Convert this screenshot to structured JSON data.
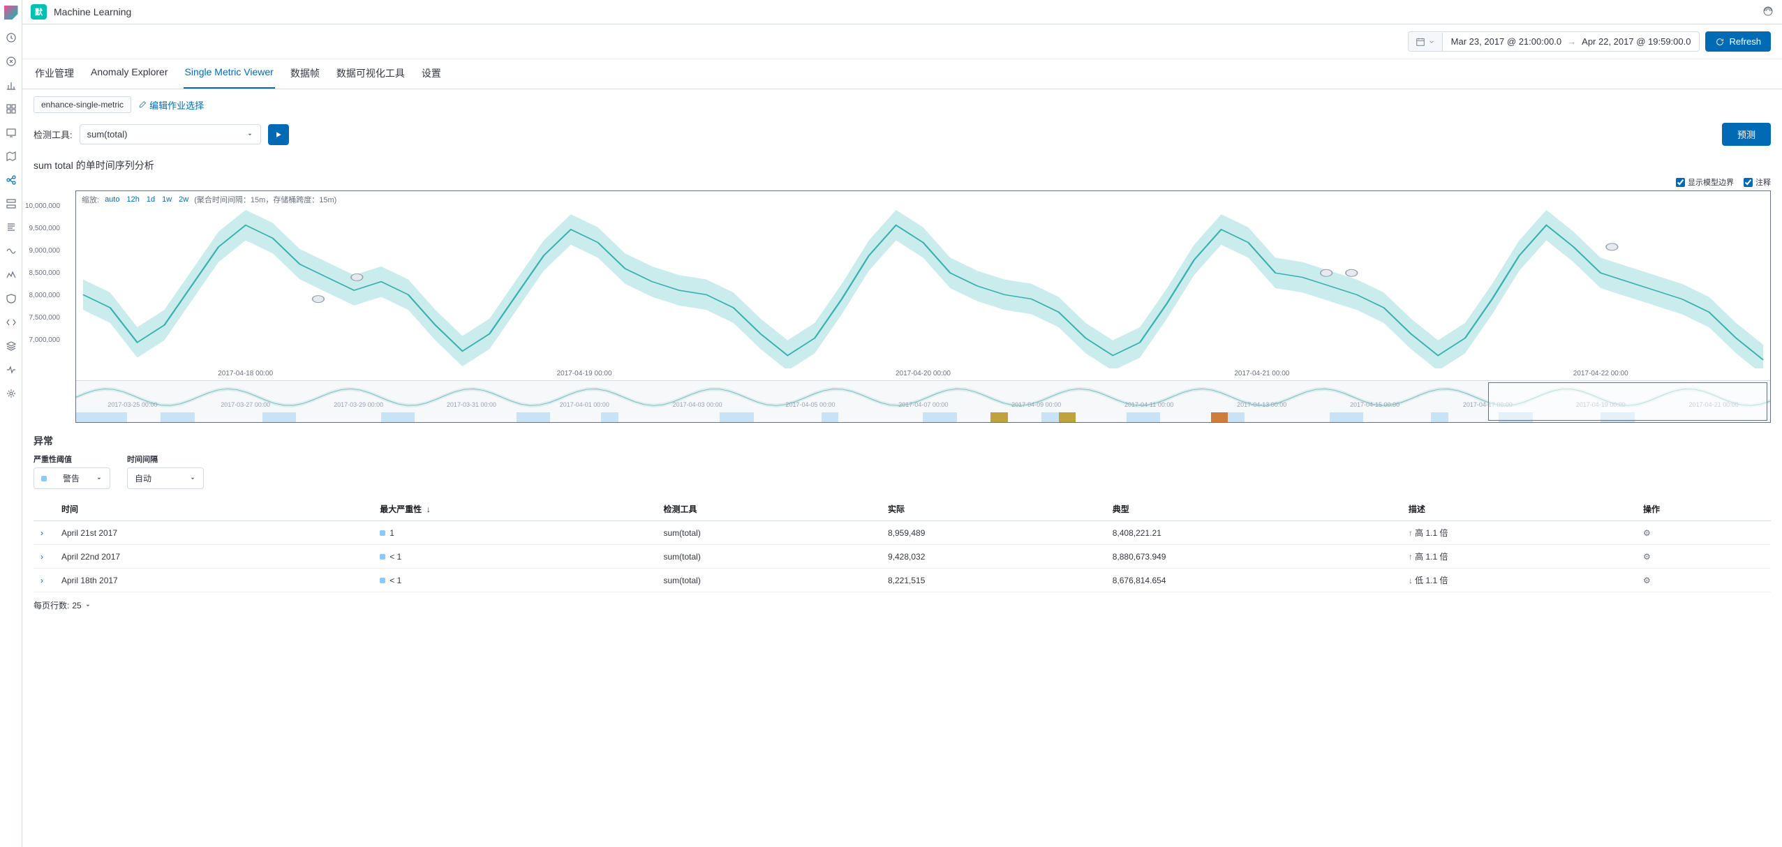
{
  "header": {
    "badge": "默",
    "breadcrumb": "Machine Learning"
  },
  "date": {
    "from": "Mar 23, 2017 @ 21:00:00.0",
    "to": "Apr 22, 2017 @ 19:59:00.0",
    "refresh": "Refresh"
  },
  "tabs": [
    "作业管理",
    "Anomaly Explorer",
    "Single Metric Viewer",
    "数据帧",
    "数据可视化工具",
    "设置"
  ],
  "active_tab": 2,
  "job": {
    "chip": "enhance-single-metric",
    "edit": "编辑作业选择"
  },
  "detector": {
    "label": "检测工具:",
    "value": "sum(total)",
    "forecast": "预测"
  },
  "analysis_title": "sum total 的单时间序列分析",
  "checks": {
    "bounds": "显示模型边界",
    "annotations": "注释"
  },
  "zoom": {
    "label": "缩放:",
    "opts": [
      "auto",
      "12h",
      "1d",
      "1w",
      "2w"
    ],
    "agg": "(聚合时间间隔：15m，存储桶跨度：15m)"
  },
  "chart_data": {
    "type": "line",
    "ylabel": "",
    "ylim": [
      6700000,
      10200000
    ],
    "yticks": [
      "10,000,000",
      "9,500,000",
      "9,000,000",
      "8,500,000",
      "8,000,000",
      "7,500,000",
      "7,000,000"
    ],
    "xticks": [
      "2017-04-18 00:00",
      "2017-04-19 00:00",
      "2017-04-20 00:00",
      "2017-04-21 00:00",
      "2017-04-22 00:00"
    ],
    "series": [
      {
        "name": "actual",
        "values": [
          8300000,
          8000000,
          7200000,
          7600000,
          8500000,
          9400000,
          9900000,
          9600000,
          9000000,
          8700000,
          8400000,
          8600000,
          8300000,
          7600000,
          7000000,
          7400000,
          8300000,
          9200000,
          9800000,
          9500000,
          8900000,
          8600000,
          8400000,
          8300000,
          8000000,
          7400000,
          6900000,
          7300000,
          8200000,
          9200000,
          9900000,
          9500000,
          8800000,
          8500000,
          8300000,
          8200000,
          7900000,
          7300000,
          6900000,
          7200000,
          8100000,
          9100000,
          9800000,
          9500000,
          8800000,
          8700000,
          8500000,
          8300000,
          8000000,
          7400000,
          6900000,
          7300000,
          8200000,
          9200000,
          9900000,
          9400000,
          8800000,
          8600000,
          8400000,
          8200000,
          7900000,
          7300000,
          6800000
        ]
      }
    ],
    "anomaly_markers": [
      {
        "x_pct": 14.0,
        "y_val": 8200000
      },
      {
        "x_pct": 16.3,
        "y_val": 8700000
      },
      {
        "x_pct": 74.0,
        "y_val": 8800000
      },
      {
        "x_pct": 75.5,
        "y_val": 8800000
      },
      {
        "x_pct": 91.0,
        "y_val": 9400000
      }
    ],
    "mini_xticks": [
      "2017-03-25 00:00",
      "2017-03-27 00:00",
      "2017-03-29 00:00",
      "2017-03-31 00:00",
      "2017-04-01 00:00",
      "2017-04-03 00:00",
      "2017-04-05 00:00",
      "2017-04-07 00:00",
      "2017-04-09 00:00",
      "2017-04-11 00:00",
      "2017-04-13 00:00",
      "2017-04-15 00:00",
      "2017-04-17 00:00",
      "2017-04-19 00:00",
      "2017-04-21 00:00"
    ]
  },
  "anomalies": {
    "heading": "异常",
    "sev_label": "严重性阈值",
    "sev_value": "警告",
    "sev_color": "#8bc8fb",
    "interval_label": "时间间隔",
    "interval_value": "自动",
    "columns": [
      "时间",
      "最大严重性",
      "检测工具",
      "实际",
      "典型",
      "描述",
      "操作"
    ],
    "sort_col": 1,
    "rows": [
      {
        "time": "April 21st 2017",
        "sev": "1",
        "sev_color": "#8bc8fb",
        "detector": "sum(total)",
        "actual": "8,959,489",
        "typical": "8,408,221.21",
        "desc": "高 1.1 倍",
        "dir": "up"
      },
      {
        "time": "April 22nd 2017",
        "sev": "< 1",
        "sev_color": "#8bc8fb",
        "detector": "sum(total)",
        "actual": "9,428,032",
        "typical": "8,880,673.949",
        "desc": "高 1.1 倍",
        "dir": "up"
      },
      {
        "time": "April 18th 2017",
        "sev": "< 1",
        "sev_color": "#8bc8fb",
        "detector": "sum(total)",
        "actual": "8,221,515",
        "typical": "8,676,814.654",
        "desc": "低 1.1 倍",
        "dir": "down"
      }
    ],
    "pager_label": "每页行数:",
    "pager_value": "25"
  }
}
